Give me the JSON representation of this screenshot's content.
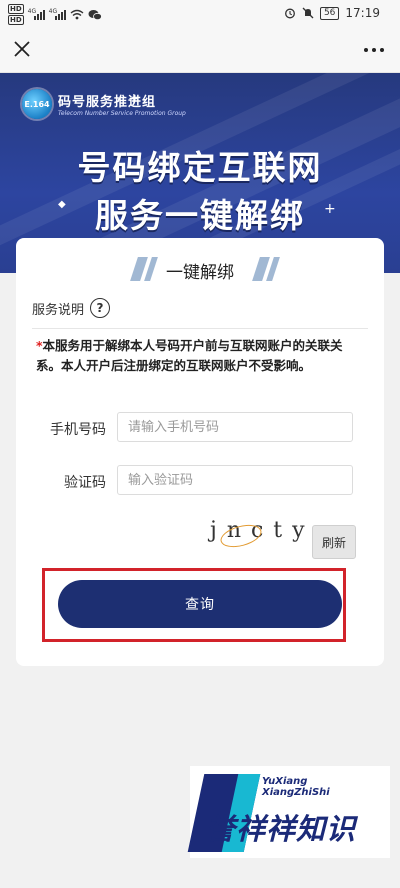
{
  "status_bar": {
    "sim1": "HD",
    "sim2": "HD",
    "net1": "4G",
    "net2": "4G",
    "battery": "56",
    "time": "17:19"
  },
  "nav": {
    "close_icon": "close-icon",
    "more_icon": "more-dots-icon"
  },
  "banner": {
    "logo_badge": "E.164",
    "org_name": "码号服务推进组",
    "org_name_en": "Telecom Number Service Promotion Group",
    "title_line1": "号码绑定互联网",
    "title_line2": "服务一键解绑"
  },
  "card": {
    "title": "一键解绑",
    "service_label": "服务说明",
    "help_glyph": "?",
    "notice_star": "*",
    "notice_text": "本服务用于解绑本人号码开户前与互联网账户的关联关系。本人开户后注册绑定的互联网账户不受影响。",
    "phone_label": "手机号码",
    "phone_placeholder": "请输入手机号码",
    "code_label": "验证码",
    "code_placeholder": "输入验证码",
    "captcha_text": "jncty",
    "refresh_label": "刷新",
    "query_label": "查询"
  },
  "watermark": {
    "en_line1": "YuXiang",
    "en_line2": "XiangZhiShi",
    "zh": "誉祥祥知识"
  },
  "colors": {
    "banner": "#26397e",
    "button": "#1d2f72",
    "highlight": "#d2232a",
    "required": "#e02020"
  }
}
